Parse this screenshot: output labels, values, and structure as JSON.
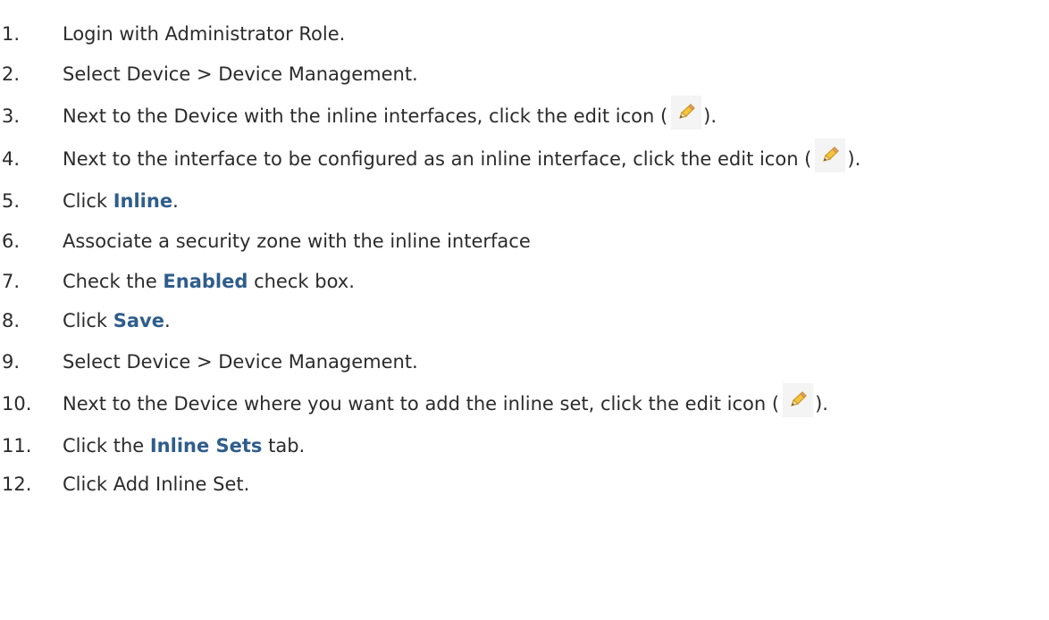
{
  "steps": [
    {
      "num": "1.",
      "parts": [
        {
          "t": "Login with Administrator Role."
        }
      ]
    },
    {
      "num": "2.",
      "parts": [
        {
          "t": "Select Device > Device Management."
        }
      ]
    },
    {
      "num": "3.",
      "parts": [
        {
          "t": "Next to the Device with the inline interfaces, click the edit icon ("
        },
        {
          "icon": "pencil-icon"
        },
        {
          "t": ")."
        }
      ]
    },
    {
      "num": "4.",
      "parts": [
        {
          "t": "Next to the interface to be configured as an inline interface, click the edit icon ("
        },
        {
          "icon": "pencil-icon"
        },
        {
          "t": ")."
        }
      ]
    },
    {
      "num": "5.",
      "parts": [
        {
          "t": "Click "
        },
        {
          "b": "Inline"
        },
        {
          "t": "."
        }
      ]
    },
    {
      "num": "6.",
      "parts": [
        {
          "t": "Associate a security zone with the inline interface"
        }
      ]
    },
    {
      "num": "7.",
      "parts": [
        {
          "t": "Check the "
        },
        {
          "b": "Enabled"
        },
        {
          "t": " check box."
        }
      ]
    },
    {
      "num": "8.",
      "parts": [
        {
          "t": "Click "
        },
        {
          "b": "Save"
        },
        {
          "t": "."
        }
      ]
    },
    {
      "num": "9.",
      "parts": [
        {
          "t": "Select Device > Device Management."
        }
      ]
    },
    {
      "num": "10.",
      "parts": [
        {
          "t": "Next to the Device where you want to add the inline set, click the edit icon ("
        },
        {
          "icon": "pencil-icon"
        },
        {
          "t": ")."
        }
      ]
    },
    {
      "num": "11.",
      "parts": [
        {
          "t": "Click the "
        },
        {
          "b": "Inline Sets"
        },
        {
          "t": " tab."
        }
      ]
    },
    {
      "num": "12.",
      "parts": [
        {
          "t": "Click Add Inline Set."
        }
      ]
    }
  ],
  "colors": {
    "text": "#2b2b2b",
    "keyword": "#2f5d8c"
  }
}
